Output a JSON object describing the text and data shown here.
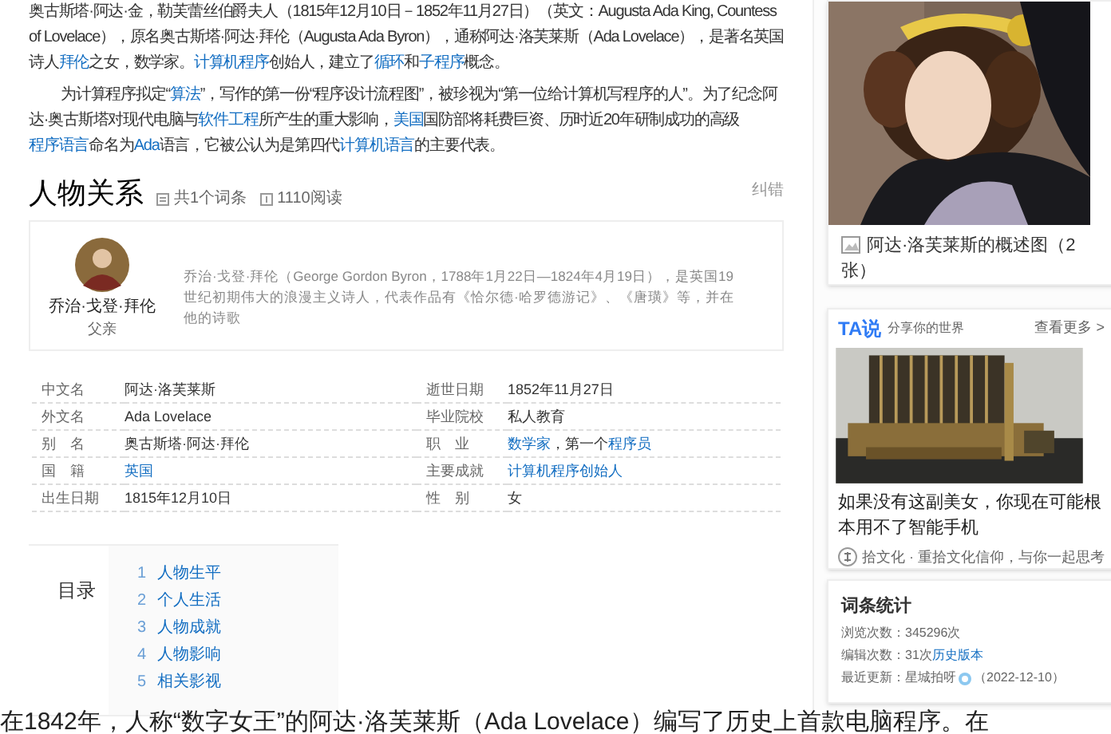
{
  "article": {
    "paragraphs": [
      {
        "segments": [
          {
            "text": "奥古斯塔·阿达·金，勒芙蕾丝伯爵夫人（1815年12月10日－1852年11月27日）（英文：Augusta Ada King, Countess of Lovelace），原名奥古斯塔·阿达·拜伦（Augusta Ada Byron），通称阿达·洛芙莱斯（Ada Lovelace），是著名英国诗人"
          },
          {
            "text": "拜伦",
            "link": true
          },
          {
            "text": "之女，数学家。"
          },
          {
            "text": "计算机程序",
            "link": true
          },
          {
            "text": "创始人，建立了"
          },
          {
            "text": "循环",
            "link": true
          },
          {
            "text": "和"
          },
          {
            "text": "子程序",
            "link": true
          },
          {
            "text": "概念。"
          }
        ]
      },
      {
        "segments": [
          {
            "text": "为计算程序拟定“"
          },
          {
            "text": "算法",
            "link": true
          },
          {
            "text": "”，写作的第一份“程序设计流程图”，被珍视为“第一位给计算机写程序的人”。为了纪念阿达·奥古斯塔对现代电脑与"
          },
          {
            "text": "软件工程",
            "link": true
          },
          {
            "text": "所产生的重大影响，"
          },
          {
            "text": "美国",
            "link": true
          },
          {
            "text": "国防部将耗费巨资、历时近20年研制成功的高级"
          },
          {
            "text": "程序语言",
            "link": true
          },
          {
            "text": "命名为"
          },
          {
            "text": "Ada",
            "link": true
          },
          {
            "text": "语言，它被公认为是第四代"
          },
          {
            "text": "计算机语言",
            "link": true
          },
          {
            "text": "的主要代表。"
          }
        ]
      }
    ]
  },
  "relations": {
    "title": "人物关系",
    "entry_count": "共1个词条",
    "reads": "1110阅读",
    "report": "纠错",
    "people": [
      {
        "name": "乔治·戈登·拜伦",
        "relation": "父亲",
        "description": "乔治·戈登·拜伦（George Gordon Byron，1788年1月22日—1824年4月19日），是英国19世纪初期伟大的浪漫主义诗人，代表作品有《恰尔德·哈罗德游记》、《唐璜》等，并在他的诗歌"
      }
    ]
  },
  "basic_info": {
    "items": [
      {
        "label": "中文名",
        "value": [
          {
            "text": "阿达·洛芙莱斯"
          }
        ]
      },
      {
        "label": "逝世日期",
        "value": [
          {
            "text": "1852年11月27日"
          }
        ]
      },
      {
        "label": "外文名",
        "value": [
          {
            "text": "Ada Lovelace"
          }
        ]
      },
      {
        "label": "毕业院校",
        "value": [
          {
            "text": "私人教育"
          }
        ]
      },
      {
        "label": "别　名",
        "value": [
          {
            "text": "奥古斯塔·阿达·拜伦"
          }
        ]
      },
      {
        "label": "职　业",
        "value": [
          {
            "text": "数学家",
            "link": true
          },
          {
            "text": "，第一个"
          },
          {
            "text": "程序员",
            "link": true
          }
        ]
      },
      {
        "label": "国　籍",
        "value": [
          {
            "text": "英国",
            "link": true
          }
        ]
      },
      {
        "label": "主要成就",
        "value": [
          {
            "text": "计算机程序创始人",
            "link": true
          }
        ]
      },
      {
        "label": "出生日期",
        "value": [
          {
            "text": "1815年12月10日"
          }
        ]
      },
      {
        "label": "性　别",
        "value": [
          {
            "text": "女"
          }
        ]
      }
    ]
  },
  "toc": {
    "title": "目录",
    "items": [
      {
        "number": "1",
        "title": "人物生平"
      },
      {
        "number": "2",
        "title": "个人生活"
      },
      {
        "number": "3",
        "title": "人物成就"
      },
      {
        "number": "4",
        "title": "人物影响"
      },
      {
        "number": "5",
        "title": "相关影视"
      }
    ]
  },
  "footer_text": "在1842年，人称“数字女王”的阿达·洛芙莱斯（Ada Lovelace）编写了历史上首款电脑程序。在",
  "sidebar": {
    "album": {
      "caption": "阿达·洛芙莱斯的概述图（2张）"
    },
    "ta_card": {
      "logo": "TA说",
      "tagline": "分享你的世界",
      "more": "查看更多 >",
      "title": "如果没有这副美女，你现在可能根本用不了智能手机",
      "source": "拾文化 · 重拾文化信仰，与你一起思考"
    },
    "stats": {
      "title": "词条统计",
      "rows": [
        {
          "segments": [
            {
              "kind": "text",
              "text": "浏览次数：345296次"
            }
          ]
        },
        {
          "segments": [
            {
              "kind": "text",
              "text": "编辑次数：31次"
            },
            {
              "kind": "link",
              "text": "历史版本"
            }
          ]
        },
        {
          "segments": [
            {
              "kind": "text",
              "text": "最近更新：星城拍呀"
            },
            {
              "kind": "icon"
            },
            {
              "kind": "text",
              "text": "（2022-12-10）"
            }
          ]
        }
      ]
    }
  }
}
